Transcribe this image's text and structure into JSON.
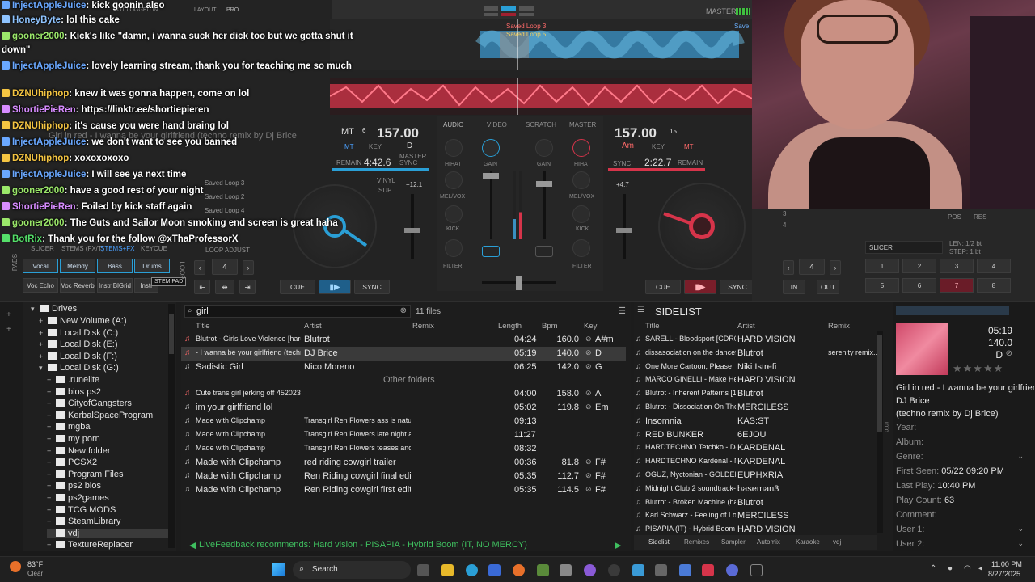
{
  "deck_left": {
    "title": "Girl in red - I wanna be your girlfriend (techno remix by Dj Brice",
    "bpm": "157.00",
    "key": "D",
    "key_label": "KEY",
    "mt": "MT",
    "remain_label": "REMAIN",
    "remain": "4:42.6",
    "master_sync": "MASTER SYNC",
    "pitch": "+12.1",
    "vinyl": "VINYL",
    "sup": "SUP",
    "num6": "6",
    "cue": "CUE",
    "sync": "SYNC",
    "loop_adjust": "LOOP ADJUST",
    "loop_value": "4",
    "saved_loops": [
      "Saved Loop 3",
      "Saved Loop 2",
      "Saved Loop 4"
    ],
    "tabs": [
      "SLICER",
      "STEMS (FX/T)",
      "STEMS+FX",
      "KEYCUE"
    ],
    "stem_pads": [
      "Vocal",
      "Melody",
      "Bass",
      "Drums"
    ],
    "stem_pads2": [
      "Voc Echo",
      "Voc Reverb",
      "Instr BlGrid",
      "Instr"
    ],
    "tooltip": "STEM PAD",
    "pads_lbl": "PADS",
    "loop_lbl": "LOOP"
  },
  "deck_right": {
    "bpm": "157.00",
    "num15": "15",
    "key": "Am",
    "key_label": "KEY",
    "mt": "MT",
    "sync_label": "SYNC",
    "remain": "2:22.7",
    "remain_label": "REMAIN",
    "pitch": "+4.7",
    "cue": "CUE",
    "sync": "SYNC",
    "slicer": "SLICER",
    "len": "LEN: 1/2 bt",
    "step": "STEP: 1 bt",
    "loop_value": "4",
    "in": "IN",
    "out": "OUT",
    "pos": "POS",
    "res": "RES",
    "pads_top": [
      "1",
      "2",
      "3",
      "4"
    ],
    "pads_bottom": [
      "5",
      "6",
      "7",
      "8"
    ],
    "small_nums": [
      "3",
      "4"
    ]
  },
  "mixer": {
    "tabs": [
      "AUDIO",
      "VIDEO",
      "SCRATCH",
      "MASTER"
    ],
    "labels_left": [
      "HIHAT",
      "MEL/VOX",
      "KICK",
      "FILTER"
    ],
    "labels_right": [
      "HIHAT",
      "MEL/VOX",
      "KICK",
      "FILTER"
    ],
    "gain": "GAIN",
    "master": "MASTER"
  },
  "waveform": {
    "saved_loop_3": "Saved Loop 3",
    "saved_loop_5": "Saved Loop 5",
    "save_tag": "Save"
  },
  "top_bar": {
    "not_logged": "NOT LOGGED IN",
    "layout": "LAYOUT",
    "layout_value": "PRO"
  },
  "chat": [
    {
      "user": "InjectAppleJuice",
      "msg": ": kick goonin also",
      "color": "#6aa8ff"
    },
    {
      "user": "HoneyByte",
      "msg": ": lol this cake",
      "color": "#8fc4ff"
    },
    {
      "user": "gooner2000",
      "msg": ": Kick's like \"damn, i wanna suck her dick too but we gotta shut it",
      "color": "#9be86a"
    },
    {
      "user": "",
      "msg": "down\"",
      "color": "#ffffff"
    },
    {
      "user": "InjectAppleJuice",
      "msg": ": lovely learning stream, thank you for teaching me so much",
      "color": "#6aa8ff"
    },
    {
      "user": "DZNUhiphop",
      "msg": ": knew it was gonna happen, come on lol",
      "color": "#f5c542"
    },
    {
      "user": "ShortiePieRen",
      "msg": ": https://linktr.ee/shortiepieren",
      "color": "#d78cff"
    },
    {
      "user": "DZNUhiphop",
      "msg": ": it's cause you were hand braing lol",
      "color": "#f5c542"
    },
    {
      "user": "InjectAppleJuice",
      "msg": ": we don't want to see you banned",
      "color": "#6aa8ff"
    },
    {
      "user": "DZNUhiphop",
      "msg": ": xoxoxoxoxo",
      "color": "#f5c542"
    },
    {
      "user": "InjectAppleJuice",
      "msg": ": I will see ya next time",
      "color": "#6aa8ff"
    },
    {
      "user": "gooner2000",
      "msg": ": have a good rest of your night",
      "color": "#9be86a"
    },
    {
      "user": "ShortiePieRen",
      "msg": ": Foiled by kick staff again",
      "color": "#d78cff"
    },
    {
      "user": "gooner2000",
      "msg": ": The Guts and Sailor Moon smoking end screen is great haha",
      "color": "#9be86a"
    },
    {
      "user": "BotRix",
      "msg": ": Thank you for the follow @xThaProfessorX",
      "color": "#55e06a"
    }
  ],
  "tree": {
    "root": "Drives",
    "items": [
      {
        "label": "New Volume (A:)",
        "level": 1
      },
      {
        "label": "Local Disk (C:)",
        "level": 1
      },
      {
        "label": "Local Disk (E:)",
        "level": 1
      },
      {
        "label": "Local Disk (F:)",
        "level": 1
      },
      {
        "label": "Local Disk (G:)",
        "level": 1
      },
      {
        "label": ".runelite",
        "level": 2
      },
      {
        "label": "bios ps2",
        "level": 2
      },
      {
        "label": "CityofGangsters",
        "level": 2
      },
      {
        "label": "KerbalSpaceProgram",
        "level": 2
      },
      {
        "label": "mgba",
        "level": 2
      },
      {
        "label": "my porn",
        "level": 2
      },
      {
        "label": "New folder",
        "level": 2
      },
      {
        "label": "PCSX2",
        "level": 2
      },
      {
        "label": "Program Files",
        "level": 2
      },
      {
        "label": "ps2 bios",
        "level": 2
      },
      {
        "label": "ps2games",
        "level": 2
      },
      {
        "label": "TCG MODS",
        "level": 2
      },
      {
        "label": "SteamLibrary",
        "level": 2
      },
      {
        "label": "vdj",
        "level": 2
      },
      {
        "label": "TextureReplacer",
        "level": 2
      }
    ]
  },
  "search": {
    "value": "girl",
    "count": "11 files"
  },
  "columns": {
    "title": "Title",
    "artist": "Artist",
    "remix": "Remix",
    "length": "Length",
    "bpm": "Bpm",
    "key": "Key"
  },
  "tracks": [
    {
      "title": "Blutrot - Girls Love Violence [hard in...",
      "artist": "Blutrot",
      "remix": "",
      "length": "04:24",
      "bpm": "160.0",
      "key": "A#m"
    },
    {
      "title": "- I wanna be your girlfriend (techno re",
      "artist": "DJ Brice",
      "remix": "",
      "length": "05:19",
      "bpm": "140.0",
      "key": "D"
    },
    {
      "title": "Sadistic Girl",
      "artist": "Nico Moreno",
      "remix": "",
      "length": "06:25",
      "bpm": "142.0",
      "key": "G"
    },
    {
      "title": "Cute trans girl jerking off 452023",
      "artist": "",
      "remix": "",
      "length": "04:00",
      "bpm": "158.0",
      "key": "A"
    },
    {
      "title": "im your girlfriend lol",
      "artist": "",
      "remix": "",
      "length": "05:02",
      "bpm": "119.8",
      "key": "Em"
    },
    {
      "title": "Made with Clipchamp",
      "artist": "Transgirl Ren Flowers ass is natural...",
      "remix": "",
      "length": "09:13",
      "bpm": "",
      "key": ""
    },
    {
      "title": "Made with Clipchamp",
      "artist": "Transgirl Ren Flowers late night ana...",
      "remix": "",
      "length": "11:27",
      "bpm": "",
      "key": ""
    },
    {
      "title": "Made with Clipchamp",
      "artist": "Transgirl Ren Flowers teases and fu...",
      "remix": "",
      "length": "08:32",
      "bpm": "",
      "key": ""
    },
    {
      "title": "Made with Clipchamp",
      "artist": "red riding cowgirl trailer",
      "remix": "",
      "length": "00:36",
      "bpm": "81.8",
      "key": "F#"
    },
    {
      "title": "Made with Clipchamp",
      "artist": "Ren Riding cowgirl final edit",
      "remix": "",
      "length": "05:35",
      "bpm": "112.7",
      "key": "F#"
    },
    {
      "title": "Made with Clipchamp",
      "artist": "Ren Riding cowgirl first edit",
      "remix": "",
      "length": "05:35",
      "bpm": "114.5",
      "key": "F#"
    }
  ],
  "other_folders": "Other folders",
  "recommend": "LiveFeedback recommends: Hard vision - PISAPIA - Hybrid Boom (IT, NO MERCY)",
  "sidelist": {
    "title": "SIDELIST",
    "col_title": "Title",
    "col_artist": "Artist",
    "col_remix": "Remix",
    "rows": [
      {
        "title": "SARELL - Bloodsport [CDR001]",
        "artist": "HARD VISION",
        "remix": ""
      },
      {
        "title": "dissasociation on the dancefloor",
        "artist": "Blutrot",
        "remix": "serenity remix..."
      },
      {
        "title": "One More Cartoon, Please",
        "artist": "Niki Istrefi",
        "remix": ""
      },
      {
        "title": "MARCO GINELLI - Make Her...",
        "artist": "HARD VISION",
        "remix": ""
      },
      {
        "title": "Blutrot - Inherent Patterns [15...",
        "artist": "Blutrot",
        "remix": ""
      },
      {
        "title": "Blutrot - Dissociation On The...",
        "artist": "MERCILESS",
        "remix": ""
      },
      {
        "title": "Insomnia",
        "artist": "KAS:ST",
        "remix": ""
      },
      {
        "title": "RED BUNKER",
        "artist": "6EJOU",
        "remix": ""
      },
      {
        "title": "HARDTECHNO Tetchko - De...",
        "artist": "KARDENAL",
        "remix": ""
      },
      {
        "title": "HARDTECHNO Kardenal - N...",
        "artist": "KARDENAL",
        "remix": ""
      },
      {
        "title": "OGUZ, Nyctonian - GOLDEN...",
        "artist": "EUPHXRIA",
        "remix": ""
      },
      {
        "title": "Midnight Club 2 soundtrack-S...",
        "artist": "baseman3",
        "remix": ""
      },
      {
        "title": "Blutrot - Broken Machine (har...",
        "artist": "Blutrot",
        "remix": ""
      },
      {
        "title": "Karl Schwarz - Feeling of Love",
        "artist": "MERCILESS",
        "remix": ""
      },
      {
        "title": "PISAPIA (IT) - Hybrid Boom [...",
        "artist": "HARD VISION",
        "remix": ""
      }
    ],
    "tabs": [
      "Sidelist",
      "Remixes",
      "Sampler",
      "Automix",
      "Karaoke",
      "vdj"
    ],
    "side_tab": "sideview"
  },
  "info": {
    "time": "05:19",
    "bpm": "140.0",
    "key": "D",
    "title": "Girl in red - I wanna be your girlfriend",
    "artist": "DJ Brice",
    "remix": "(techno remix by Dj Brice)",
    "year_lbl": "Year:",
    "album_lbl": "Album:",
    "genre_lbl": "Genre:",
    "first_seen_lbl": "First Seen:",
    "first_seen": "05/22 09:20 PM",
    "last_play_lbl": "Last Play:",
    "last_play": "10:40 PM",
    "play_count_lbl": "Play Count:",
    "play_count": "63",
    "comment_lbl": "Comment:",
    "user1_lbl": "User 1:",
    "user2_lbl": "User 2:",
    "side_tab": "info"
  },
  "tree_side_tab": "folders",
  "taskbar": {
    "weather_temp": "83°F",
    "weather_desc": "Clear",
    "search": "Search",
    "time": "11:00 PM",
    "date": "8/27/2025"
  },
  "colors": {
    "accent_blue": "#2a9fd6",
    "waveform_red": "#d6344a",
    "waveform_blue": "#3a8fc0",
    "play_red": "#e0324a"
  }
}
